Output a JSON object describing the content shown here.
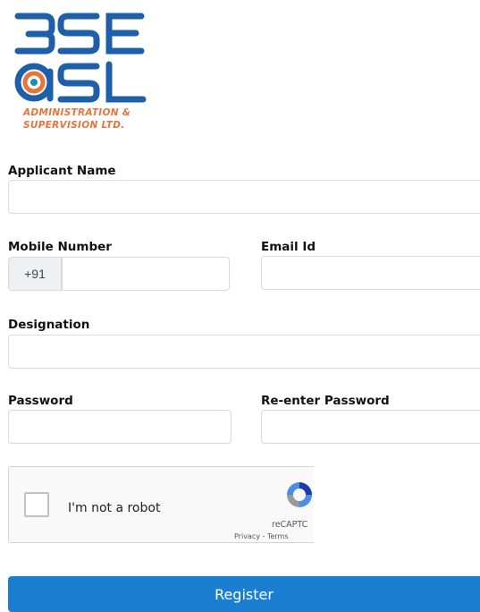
{
  "brand": {
    "logo_line1": "BSE",
    "logo_line2": "ASL",
    "subtitle_line1": "ADMINISTRATION &",
    "subtitle_line2": "SUPERVISION LTD.",
    "colors": {
      "blue": "#1f5fa8",
      "orange": "#e8743a",
      "teal": "#1f8fb0"
    }
  },
  "form": {
    "applicant_name_label": "Applicant Name",
    "applicant_name_value": "",
    "mobile_label": "Mobile Number",
    "mobile_prefix": "+91",
    "mobile_value": "",
    "email_label": "Email Id",
    "email_value": "",
    "designation_label": "Designation",
    "designation_value": "",
    "password_label": "Password",
    "password_value": "",
    "reenter_password_label": "Re-enter Password",
    "reenter_password_value": ""
  },
  "captcha": {
    "checkbox_label": "I'm not a robot",
    "brand": "reCAPTC",
    "privacy": "Privacy",
    "separator": " - ",
    "terms": "Terms"
  },
  "actions": {
    "register_label": "Register",
    "register_color": "#1a7fd1"
  }
}
